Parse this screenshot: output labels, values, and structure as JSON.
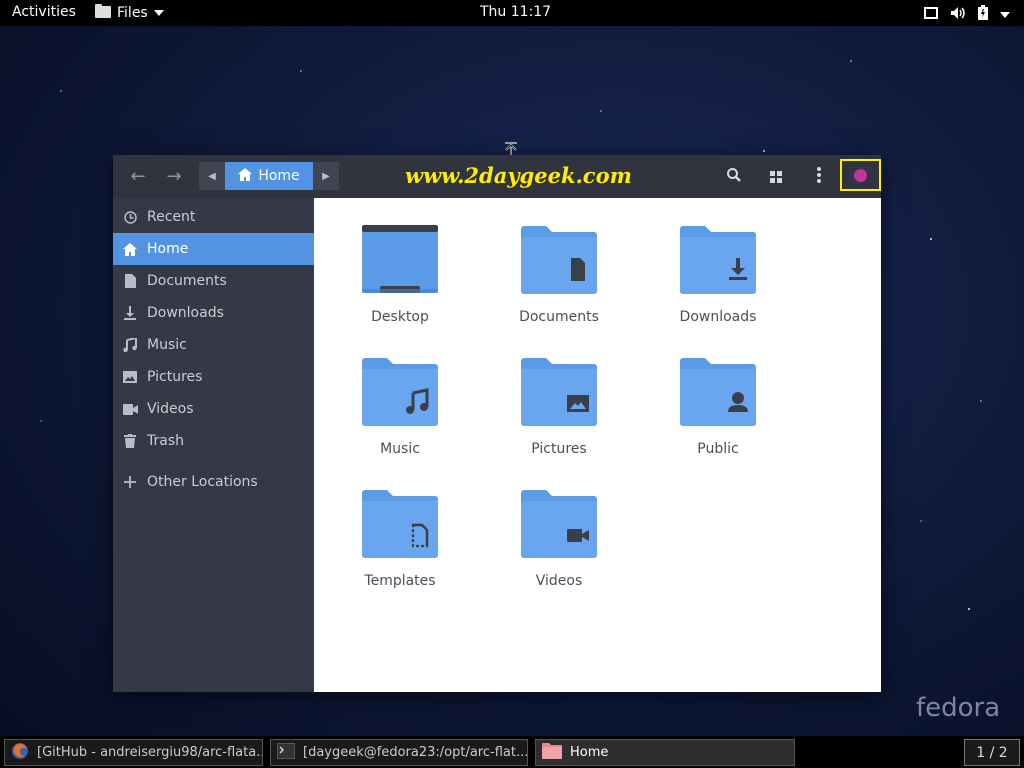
{
  "topbar": {
    "activities": "Activities",
    "app_menu": "Files",
    "clock": "Thu 11:17"
  },
  "window": {
    "path_current": "Home",
    "watermark": "www.2daygeek.com"
  },
  "sidebar": {
    "items": [
      {
        "label": "Recent",
        "icon": "clock-icon"
      },
      {
        "label": "Home",
        "icon": "home-icon",
        "active": true
      },
      {
        "label": "Documents",
        "icon": "document-icon"
      },
      {
        "label": "Downloads",
        "icon": "download-icon"
      },
      {
        "label": "Music",
        "icon": "music-icon"
      },
      {
        "label": "Pictures",
        "icon": "picture-icon"
      },
      {
        "label": "Videos",
        "icon": "video-icon"
      },
      {
        "label": "Trash",
        "icon": "trash-icon"
      },
      {
        "label": "Other Locations",
        "icon": "plus-icon"
      }
    ]
  },
  "folders": [
    {
      "label": "Desktop",
      "emblem": "desktop"
    },
    {
      "label": "Documents",
      "emblem": "document"
    },
    {
      "label": "Downloads",
      "emblem": "download"
    },
    {
      "label": "Music",
      "emblem": "music"
    },
    {
      "label": "Pictures",
      "emblem": "picture"
    },
    {
      "label": "Public",
      "emblem": "person"
    },
    {
      "label": "Templates",
      "emblem": "template"
    },
    {
      "label": "Videos",
      "emblem": "video"
    }
  ],
  "desktop": {
    "logo": "fedora"
  },
  "taskbar": {
    "tasks": [
      {
        "label": "[GitHub - andreisergiu98/arc-flata..."
      },
      {
        "label": "[daygeek@fedora23:/opt/arc-flat..."
      },
      {
        "label": "Home"
      }
    ],
    "workspace": "1 / 2"
  },
  "colors": {
    "accent": "#5294e2",
    "headerbar": "#2f343f",
    "sidebar": "#353945",
    "watermark": "#ffee00",
    "close_highlight": "#fff200"
  }
}
